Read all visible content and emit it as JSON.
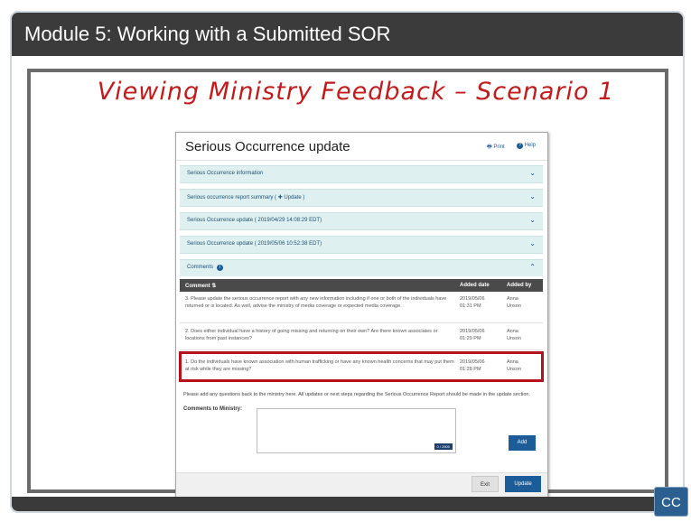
{
  "module_title": "Module 5:  Working with a Submitted SOR",
  "slide_title": "Viewing Ministry Feedback – Scenario 1",
  "screen": {
    "title": "Serious Occurrence update",
    "print_label": "Print",
    "help_label": "Help",
    "sections": [
      {
        "label": "Serious Occurrence information"
      },
      {
        "label": "Serious occurrence report summary ( ✚ Update )"
      },
      {
        "label": "Serious Occurrence update ( 2019/04/29 14:08:29 EDT)"
      },
      {
        "label": "Serious Occurrence update ( 2019/05/06 10:52:38 EDT)"
      }
    ],
    "comments_label": "Comments",
    "table": {
      "col_comment": "Comment",
      "col_added_date": "Added date",
      "col_added_by": "Added by",
      "rows": [
        {
          "comment": "3. Please update the serious occurrence report with any new information including if one or both of the individuals have returned or is located. As well, advise the ministry of media coverage or expected media coverage.",
          "date": "2019/05/06",
          "time": "01:31 PM",
          "by_first": "Anna",
          "by_last": "Unson"
        },
        {
          "comment": "2. Does either individual have a history of going missing and returning on their own? Are there known associates or locations from past instances?",
          "date": "2019/05/06",
          "time": "01:29 PM",
          "by_first": "Anna",
          "by_last": "Unson"
        },
        {
          "comment": "1. Do the individuals have known association with human trafficking or have any known health concerns that may put them at risk while they are missing?",
          "date": "2019/05/06",
          "time": "01:28 PM",
          "by_first": "Anna",
          "by_last": "Unson"
        }
      ]
    },
    "instructions": "Please add any questions back to the ministry here. All updates or next steps regarding the Serious Occurrence Report should be made in the update section.",
    "comments_to_ministry_label": "Comments to Ministry:",
    "char_counter": "0 / 2500",
    "add_label": "Add",
    "exit_label": "Exit",
    "update_label": "Update"
  },
  "cc_label": "CC",
  "colors": {
    "module_bar": "#3b3b3b",
    "slide_title": "#c31b1b",
    "accordion": "#dff0f0",
    "primary_button": "#1c5d99",
    "highlight": "#b5121b"
  }
}
